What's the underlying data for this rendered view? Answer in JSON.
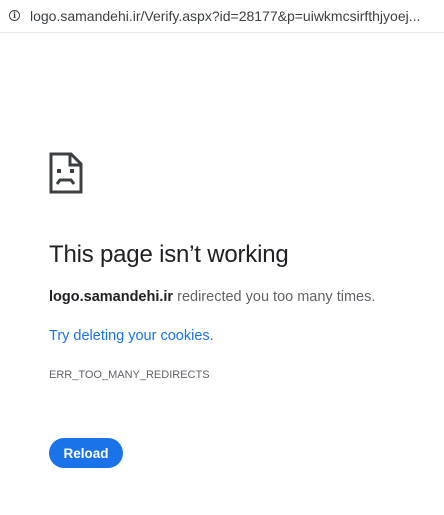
{
  "address_bar": {
    "icon": "info-icon",
    "url": "logo.samandehi.ir/Verify.aspx?id=28177&p=uiwkmcsirfthjyoej..."
  },
  "error_page": {
    "icon": "sad-document-icon",
    "title": "This page isn’t working",
    "host": "logo.samandehi.ir",
    "message": "redirected you too many times.",
    "suggestion_link": "Try deleting your cookies.",
    "error_code": "ERR_TOO_MANY_REDIRECTS",
    "reload_label": "Reload"
  },
  "colors": {
    "accent": "#1a73e8",
    "text": "#202124",
    "secondary_text": "#5f6368"
  }
}
